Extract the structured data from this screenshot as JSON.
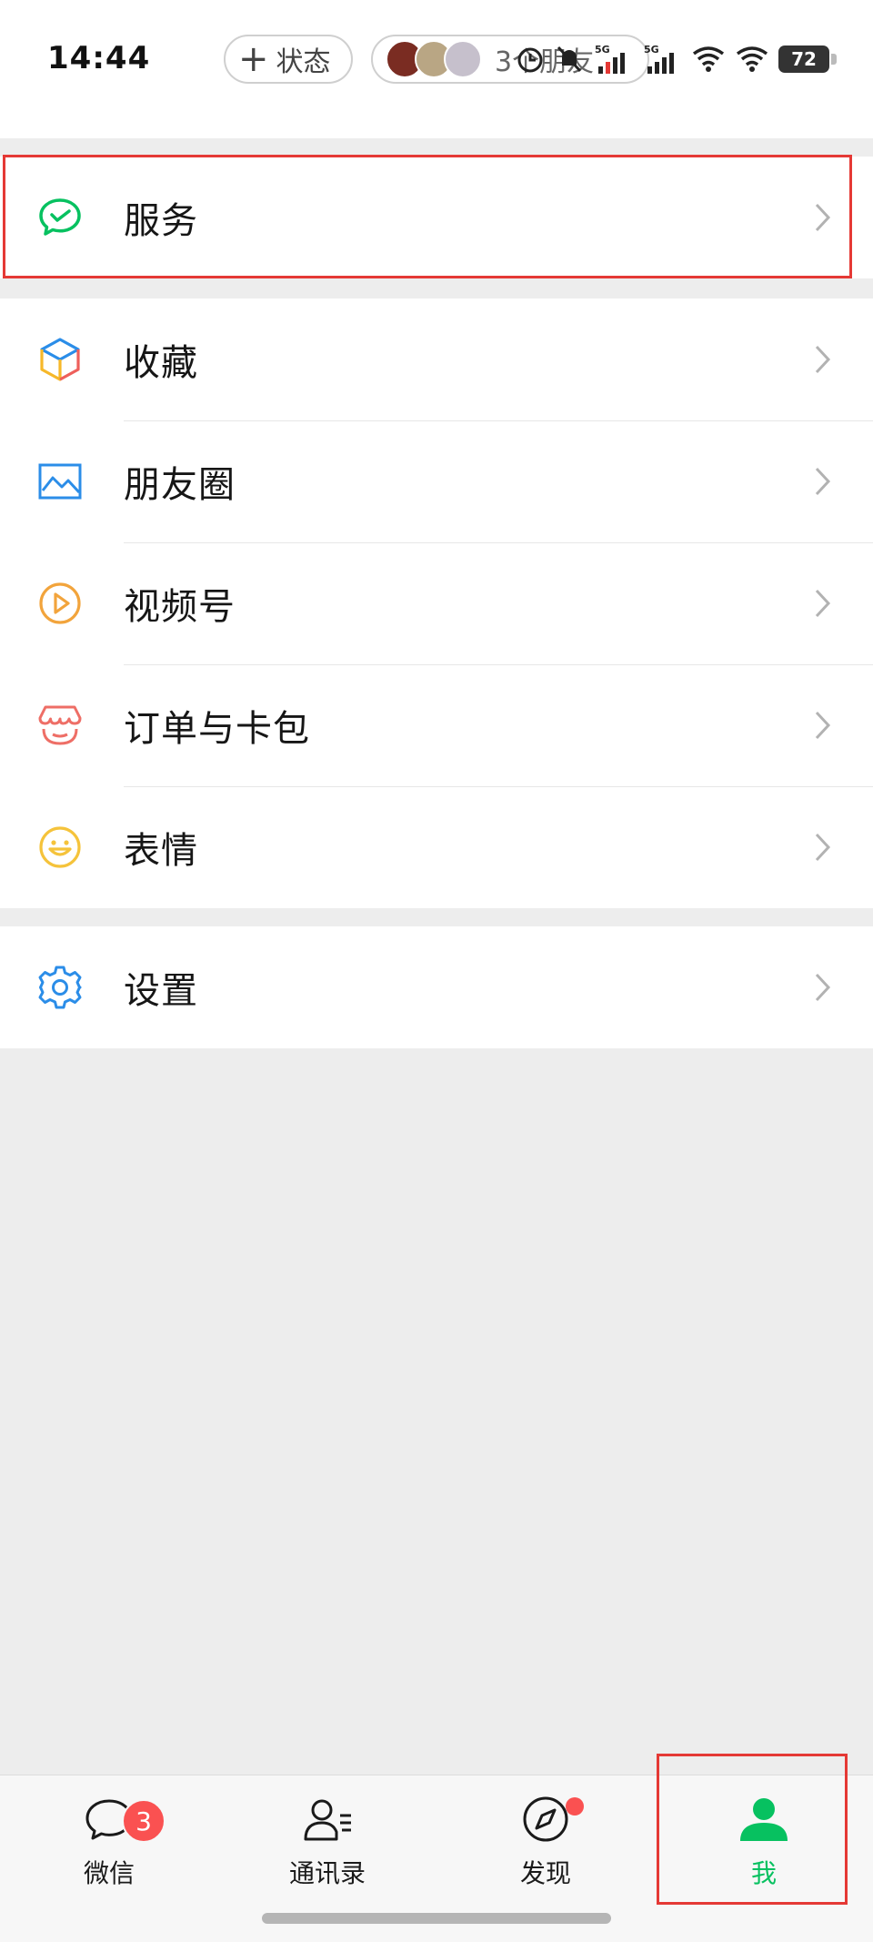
{
  "status_bar": {
    "time": "14:44",
    "status_pill": {
      "plus": "+",
      "label": "状态"
    },
    "friends_pill": {
      "label": "3个朋友"
    },
    "battery": "72"
  },
  "menu": {
    "service": {
      "label": "服务",
      "icon": "wechat-pay-icon",
      "color": "#07c160"
    },
    "group2": [
      {
        "key": "favorites",
        "label": "收藏",
        "icon": "cube-icon"
      },
      {
        "key": "moments",
        "label": "朋友圈",
        "icon": "image-icon"
      },
      {
        "key": "channels",
        "label": "视频号",
        "icon": "play-circle-icon"
      },
      {
        "key": "orders",
        "label": "订单与卡包",
        "icon": "shop-icon"
      },
      {
        "key": "stickers",
        "label": "表情",
        "icon": "smile-icon"
      }
    ],
    "settings": {
      "label": "设置",
      "icon": "gear-icon"
    }
  },
  "tabbar": {
    "items": [
      {
        "key": "chats",
        "label": "微信",
        "icon": "chat-bubble-icon",
        "badge": "3"
      },
      {
        "key": "contacts",
        "label": "通讯录",
        "icon": "contacts-icon"
      },
      {
        "key": "discover",
        "label": "发现",
        "icon": "compass-icon",
        "dot": true
      },
      {
        "key": "me",
        "label": "我",
        "icon": "person-icon",
        "active": true
      }
    ],
    "active_color": "#07c160",
    "badge_color": "#fa5151"
  },
  "annotation_color": "#e53935"
}
